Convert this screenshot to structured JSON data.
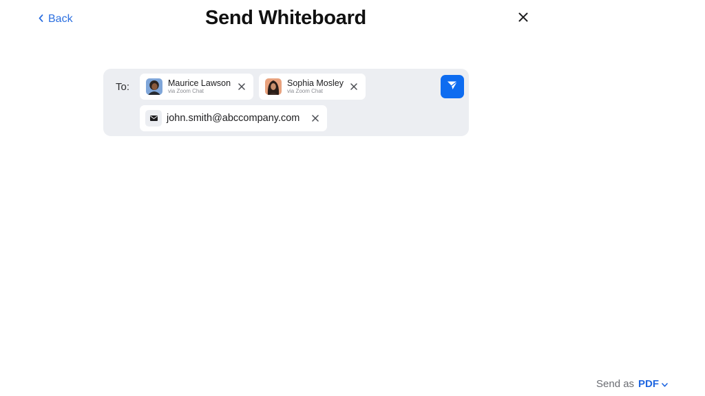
{
  "header": {
    "back_label": "Back",
    "title": "Send Whiteboard"
  },
  "recipients": {
    "to_label": "To:",
    "contacts": [
      {
        "name": "Maurice Lawson",
        "via": "via Zoom Chat"
      },
      {
        "name": "Sophia Mosley",
        "via": "via Zoom Chat"
      }
    ],
    "email": "john.smith@abccompany.com"
  },
  "footer": {
    "send_as_label": "Send as",
    "format": "PDF"
  },
  "icons": {
    "back": "chevron-left-icon",
    "close": "close-icon",
    "remove": "close-icon",
    "mail": "envelope-icon",
    "send": "paper-plane-icon",
    "format": "chevron-down-icon"
  },
  "colors": {
    "accent": "#0e6cf0",
    "link": "#2b6fe0",
    "panel_bg": "#eceef2"
  }
}
